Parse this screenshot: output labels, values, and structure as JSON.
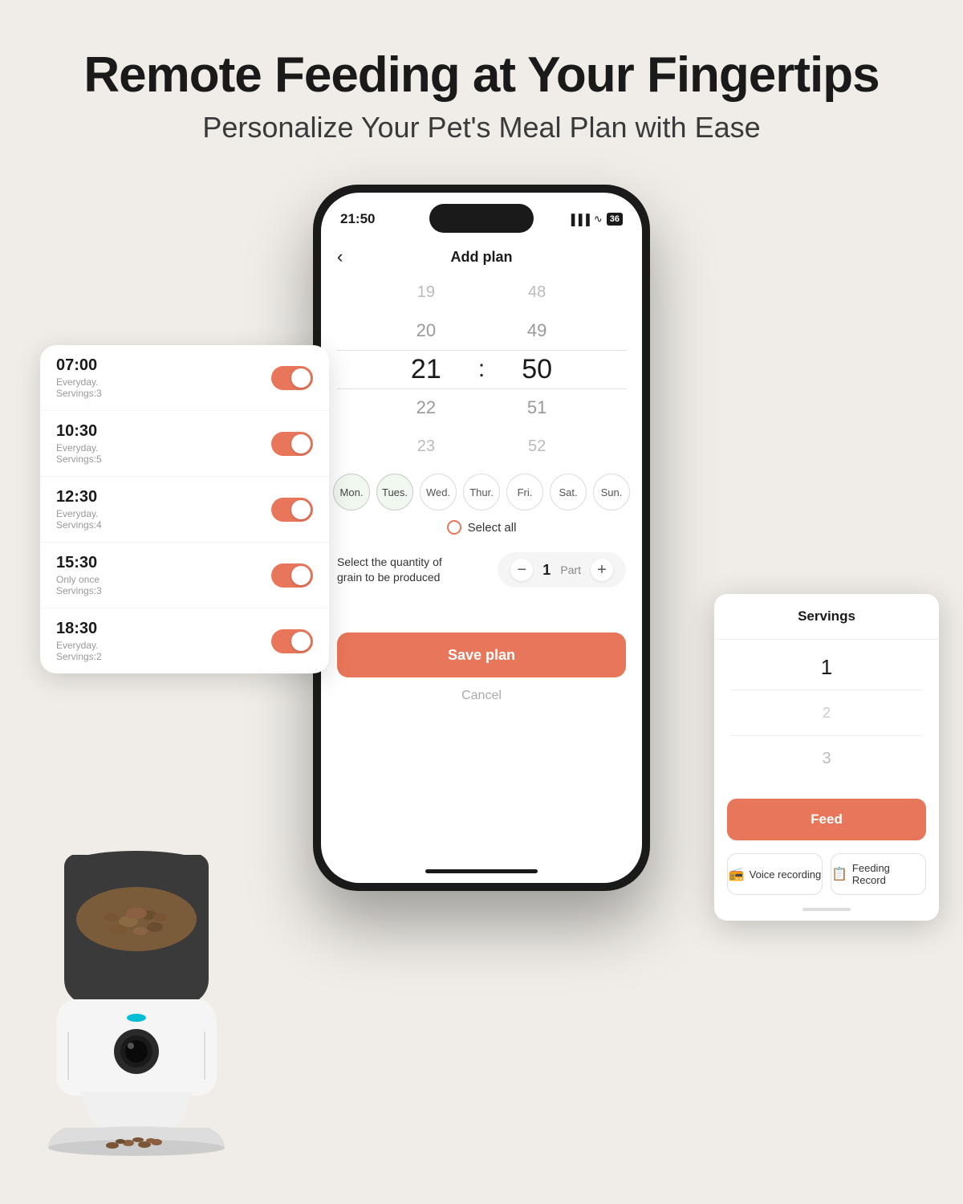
{
  "header": {
    "title": "Remote Feeding at Your Fingertips",
    "subtitle": "Personalize Your Pet's Meal Plan with Ease"
  },
  "status_bar": {
    "time": "21:50",
    "battery": "36"
  },
  "app": {
    "title": "Add plan",
    "back_label": "‹"
  },
  "time_picker": {
    "hour_above": "19",
    "hour_selected": "20",
    "hour_below": "21",
    "hour_below2": "22",
    "hour_below3": "23",
    "minute_above": "48",
    "minute_selected": "49",
    "minute_middle": "50",
    "minute_below": "51",
    "minute_below2": "52"
  },
  "days": [
    {
      "label": "Mon.",
      "active": true
    },
    {
      "label": "Tues.",
      "active": true
    },
    {
      "label": "Wed.",
      "active": false
    },
    {
      "label": "Thur.",
      "active": false
    },
    {
      "label": "Fri.",
      "active": false
    },
    {
      "label": "Sat.",
      "active": false
    },
    {
      "label": "Sun.",
      "active": false
    }
  ],
  "select_all": "Select all",
  "quantity": {
    "label": "Select the quantity of grain to be produced",
    "value": "1",
    "unit": "Part",
    "minus": "−",
    "plus": "+"
  },
  "buttons": {
    "save_plan": "Save plan",
    "cancel": "Cancel"
  },
  "plan_list": [
    {
      "time": "07:00",
      "repeat": "Everyday.",
      "servings": "Servings:3"
    },
    {
      "time": "10:30",
      "repeat": "Everyday.",
      "servings": "Servings:5"
    },
    {
      "time": "12:30",
      "repeat": "Everyday.",
      "servings": "Servings:4"
    },
    {
      "time": "15:30",
      "repeat": "Only once",
      "servings": "Servings:3"
    },
    {
      "time": "18:30",
      "repeat": "Everyday.",
      "servings": "Servings:2"
    }
  ],
  "servings_popup": {
    "title": "Servings",
    "values": [
      "1",
      "2",
      "3"
    ],
    "selected_index": 0,
    "feed_label": "Feed",
    "voice_recording_label": "Voice recording",
    "feeding_record_label": "Feeding Record"
  }
}
